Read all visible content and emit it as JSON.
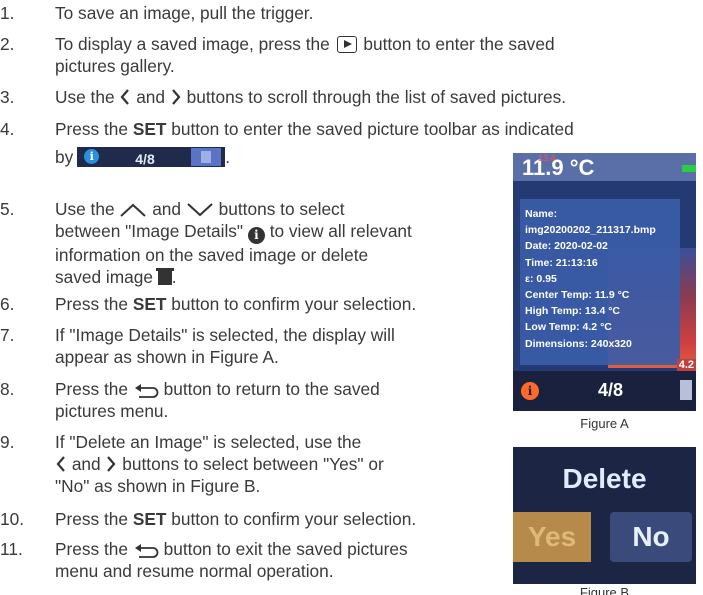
{
  "steps": [
    {
      "num": "1.",
      "lines": [
        "To save an image, pull the trigger."
      ]
    },
    {
      "num": "2.",
      "lines": [
        "To display a saved image, press the",
        "button to enter the saved",
        "pictures gallery."
      ]
    },
    {
      "num": "3.",
      "lines": [
        "Use the",
        "and",
        "buttons to scroll through the list of saved pictures."
      ]
    },
    {
      "num": "4.",
      "lines": [
        "Press the",
        "SET",
        "button to enter the saved picture toolbar as indicated",
        "by",
        "."
      ]
    },
    {
      "num": "5.",
      "lines": [
        "Use the",
        "and",
        "buttons to select",
        "between \"Image Details\"",
        "to view all relevant",
        "information on the saved image or delete",
        "saved image",
        "."
      ]
    },
    {
      "num": "6.",
      "lines": [
        "Press the",
        "SET",
        "button to confirm your selection."
      ]
    },
    {
      "num": "7.",
      "lines": [
        "If \"Image Details\" is selected, the display will",
        "appear as shown in Figure A."
      ]
    },
    {
      "num": "8.",
      "lines": [
        "Press the",
        "button to return to the saved",
        "pictures menu."
      ]
    },
    {
      "num": "9.",
      "lines": [
        "If \"Delete an Image\" is selected, use the",
        "and",
        "buttons to select between \"Yes\" or",
        "\"No\" as shown in Figure B."
      ]
    },
    {
      "num": "10.",
      "lines": [
        "Press the",
        "SET",
        "button to confirm your selection."
      ]
    },
    {
      "num": "11.",
      "lines": [
        "Press the",
        "button to exit the saved pictures",
        "menu and resume normal operation."
      ]
    }
  ],
  "toolbar_counter": "4/8",
  "figureA": {
    "temp": "11.9 °C",
    "small": "13.4",
    "info": [
      "Name:",
      "img20200202_211317.bmp",
      "Date: 2020-02-02",
      "Time: 21:13:16",
      "ε: 0.95",
      "Center Temp: 11.9 °C",
      "High Temp: 13.4 °C",
      "Low Temp: 4.2 °C",
      "Dimensions: 240x320"
    ],
    "corner": "4.2",
    "counter": "4/8",
    "caption": "Figure A"
  },
  "figureB": {
    "title": "Delete",
    "yes": "Yes",
    "no": "No",
    "caption": "Figure B"
  }
}
